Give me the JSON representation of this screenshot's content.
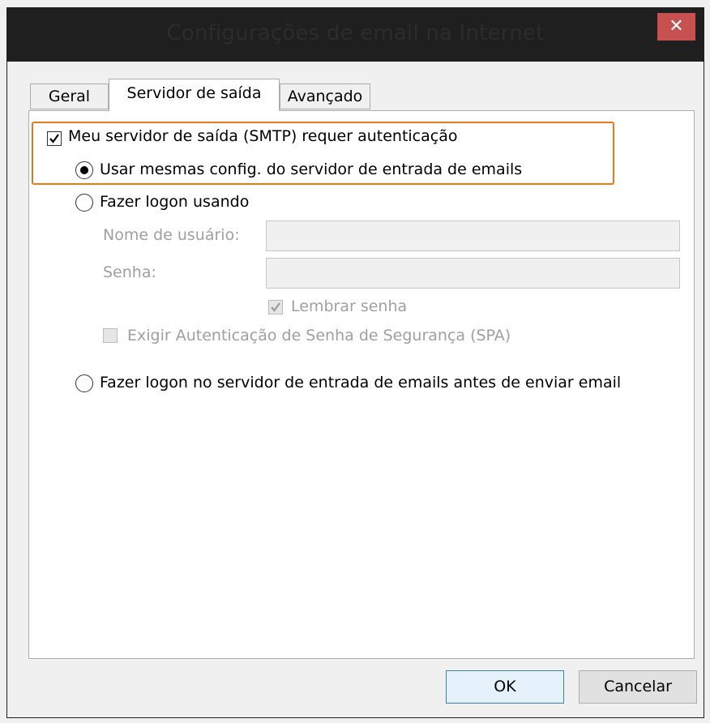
{
  "window": {
    "title": "Configurações de email na Internet",
    "close_label": "✕"
  },
  "tabs": [
    {
      "label": "Geral",
      "active": false
    },
    {
      "label": "Servidor de saída",
      "active": true
    },
    {
      "label": "Avançado",
      "active": false
    }
  ],
  "auth": {
    "smtp_requires_auth_label": "Meu servidor de saída (SMTP) requer autenticação",
    "smtp_requires_auth_checked": true,
    "use_same_settings_label": "Usar mesmas config. do servidor de entrada de emails",
    "logon_using_label": "Fazer logon usando",
    "username_label": "Nome de usuário:",
    "username_value": "",
    "password_label": "Senha:",
    "password_value": "",
    "remember_password_label": "Lembrar senha",
    "remember_password_checked": true,
    "spa_label": "Exigir Autenticação de Senha de Segurança (SPA)",
    "spa_checked": false,
    "logon_incoming_first_label": "Fazer logon no servidor de entrada de emails antes de enviar email",
    "selected_option": "use_same_settings"
  },
  "buttons": {
    "ok_label": "OK",
    "cancel_label": "Cancelar"
  },
  "colors": {
    "highlight_border": "#e07b21",
    "close_button": "#c75050",
    "titlebar": "#1f1f1f"
  }
}
